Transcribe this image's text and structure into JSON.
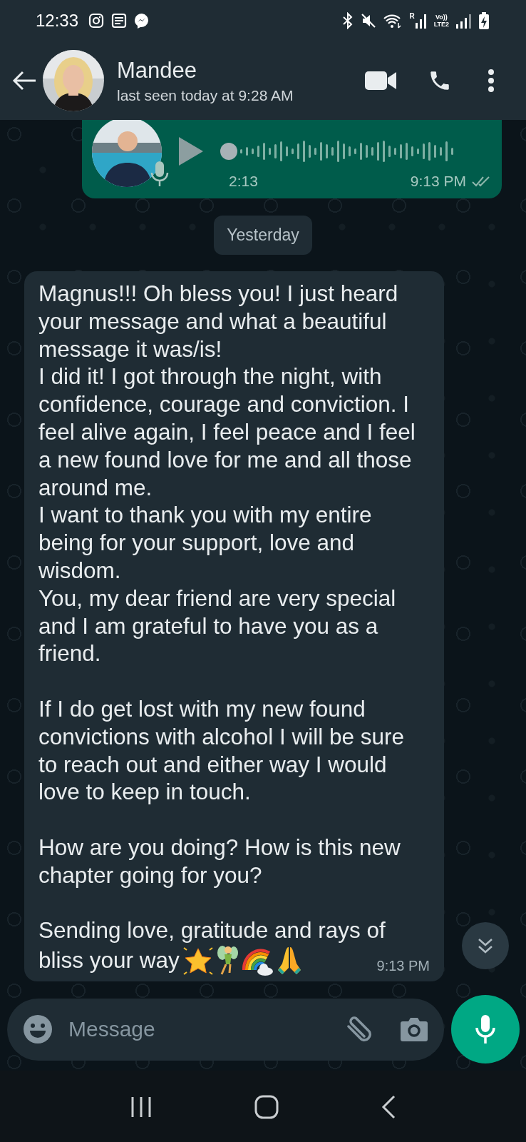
{
  "status_bar": {
    "time": "12:33",
    "signal_label": "R",
    "network_label_top": "Vo))",
    "network_label_bottom": "LTE2"
  },
  "header": {
    "contact_name": "Mandee",
    "last_seen": "last seen today at 9:28 AM"
  },
  "voice_message": {
    "duration": "2:13",
    "time": "9:13 PM",
    "read": false
  },
  "date_chip": "Yesterday",
  "message": {
    "text": "Magnus!!! Oh bless you! I just heard your message and what a beautiful message it was/is!\nI did it! I got through the night, with confidence, courage and conviction. I feel alive again, I feel peace and I feel a new found love for me and all those around me.\nI want to thank you with my entire being for your support, love and wisdom.\nYou, my dear friend are very special and I am grateful to have you as a friend.\n\nIf I do get lost with my new found convictions with alcohol I will be sure to reach out and either way I would love to keep in touch.\n\nHow are you doing? How is this new chapter going for you?\n\nSending love, gratitude and rays of",
    "last_line": "bliss your way",
    "emojis": [
      {
        "kind": "star"
      },
      {
        "kind": "fairy"
      },
      {
        "kind": "rainbow"
      },
      {
        "kind": "praying-hands"
      }
    ],
    "time": "9:13 PM"
  },
  "composer": {
    "placeholder": "Message"
  }
}
